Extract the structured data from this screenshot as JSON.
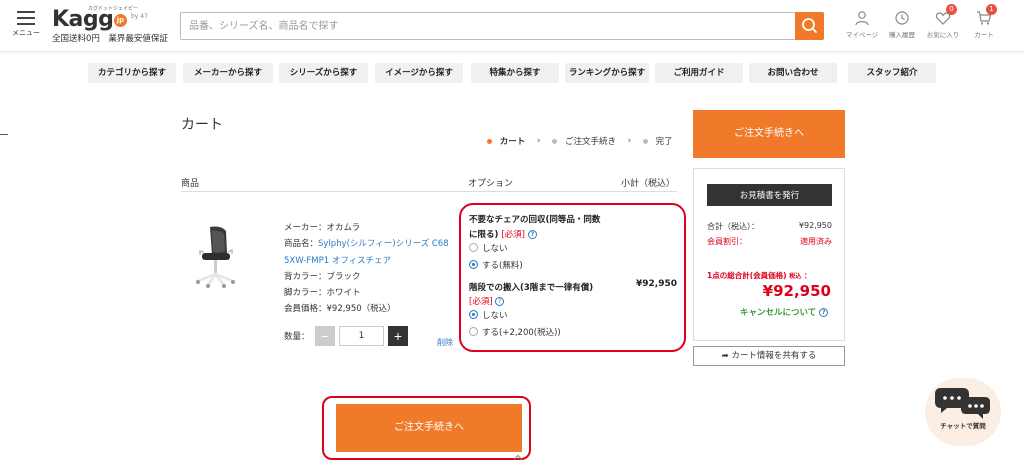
{
  "header": {
    "menu_label": "メニュー",
    "brand": "Kagg",
    "brand_jp": "jp",
    "brand_ruby": "カグドットジェイピー",
    "brand_by": "by 47",
    "tagline": "全国送料0円　業界最安値保証",
    "search_placeholder": "品番、シリーズ名、商品名で探す",
    "icons": [
      {
        "icon": "user-icon",
        "label": "マイページ"
      },
      {
        "icon": "history-icon",
        "label": "購入履歴"
      },
      {
        "icon": "heart-icon",
        "label": "お気に入り",
        "badge": "0"
      },
      {
        "icon": "cart-icon",
        "label": "カート",
        "badge": "1"
      }
    ]
  },
  "nav": [
    "カテゴリから探す",
    "メーカーから探す",
    "シリーズから探す",
    "イメージから探す",
    "特集から探す",
    "ランキングから探す",
    "ご利用ガイド",
    "お問い合わせ",
    "スタッフ紹介"
  ],
  "cart": {
    "title": "カート",
    "steps": [
      "カート",
      "ご注文手続き",
      "完了"
    ],
    "steps_colors": {
      "active": "#f07a2a",
      "inactive": "#bbbbbb"
    },
    "col_product": "商品",
    "col_option": "オプション",
    "col_subtotal": "小計（税込）",
    "product": {
      "maker": "メーカー：オカムラ",
      "name_label": "商品名：",
      "name_link_1": "Sylphy(シルフィー)シリーズ C68",
      "name_link_2": "5XW-FMP1 オフィスチェア",
      "back_color": "背カラー：ブラック",
      "leg_color": "脚カラー：ホワイト",
      "member_price": "会員価格：¥92,950（税込）"
    },
    "qty_label": "数量：",
    "qty_value": "1",
    "delete": "削除",
    "options": {
      "q1_line1": "不要なチェアの回収(同等品・同数",
      "q1_line2": "に限る)",
      "required": "[必須]",
      "q1_choices": [
        "しない",
        "する(無料)"
      ],
      "q1_selected": 1,
      "q2_line1": "階段での搬入(3階まで一律有償)",
      "q2_choices": [
        "しない",
        "する(+2,200(税込))"
      ],
      "q2_selected": 0
    },
    "subtotal": "¥92,950",
    "checkout": "ご注文手続きへ"
  },
  "summary": {
    "checkout": "ご注文手続きへ",
    "quote": "お見積書を発行",
    "total_label": "合計（税込）：",
    "total_value": "¥92,950",
    "discount_label": "会員割引：",
    "discount_value": "適用済み",
    "grand_label": "1点の総合計(会員価格)",
    "grand_tax": "税込",
    "grand_value": "¥92,950",
    "cancel": "キャンセルについて",
    "share": "カート情報を共有する"
  },
  "chat": {
    "label": "チャットで質問"
  },
  "colors": {
    "accent": "#f07a2a",
    "highlight": "#e0001a",
    "link": "#2a7ac0",
    "success": "#3a9a3a"
  }
}
